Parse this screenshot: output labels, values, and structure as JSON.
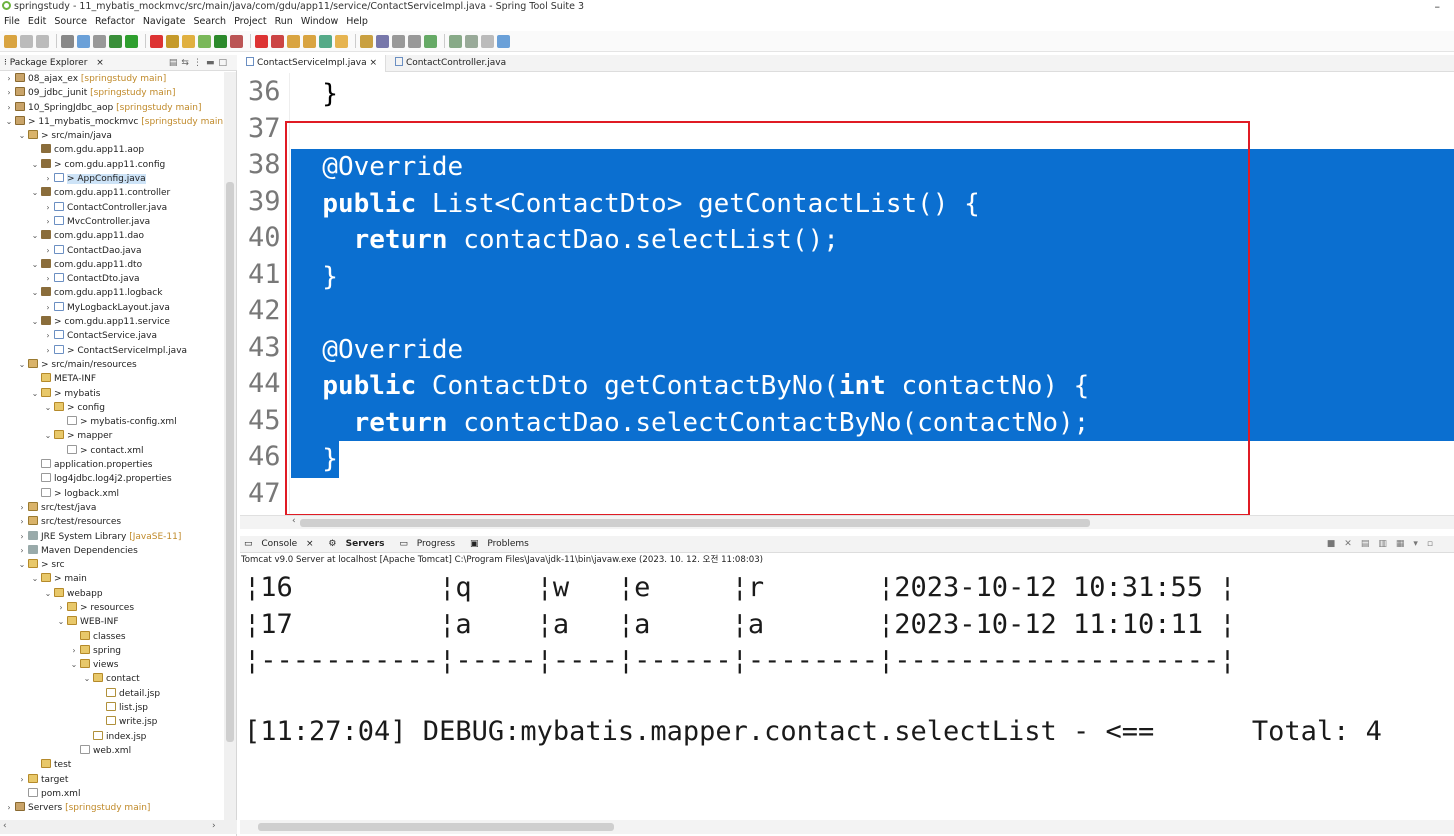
{
  "window": {
    "title": "springstudy - 11_mybatis_mockmvc/src/main/java/com/gdu/app11/service/ContactServiceImpl.java - Spring Tool Suite 3"
  },
  "menu": [
    "File",
    "Edit",
    "Source",
    "Refactor",
    "Navigate",
    "Search",
    "Project",
    "Run",
    "Window",
    "Help"
  ],
  "explorer": {
    "tab_label": "Package Explorer",
    "tree": [
      {
        "indent": 0,
        "twisty": ">",
        "icon": "proj",
        "label": "08_ajax_ex",
        "decoration": "[springstudy main]"
      },
      {
        "indent": 0,
        "twisty": ">",
        "icon": "proj",
        "label": "09_jdbc_junit",
        "decoration": "[springstudy main]"
      },
      {
        "indent": 0,
        "twisty": ">",
        "icon": "proj",
        "label": "10_SpringJdbc_aop",
        "decoration": "[springstudy main]"
      },
      {
        "indent": 0,
        "twisty": "v",
        "icon": "proj",
        "label": "> 11_mybatis_mockmvc",
        "decoration": "[springstudy main]"
      },
      {
        "indent": 1,
        "twisty": "v",
        "icon": "src",
        "label": "> src/main/java",
        "decoration": ""
      },
      {
        "indent": 2,
        "twisty": "",
        "icon": "pkg",
        "label": "com.gdu.app11.aop",
        "decoration": ""
      },
      {
        "indent": 2,
        "twisty": "v",
        "icon": "pkg",
        "label": "> com.gdu.app11.config",
        "decoration": ""
      },
      {
        "indent": 3,
        "twisty": ">",
        "icon": "java",
        "label": "> AppConfig.java",
        "decoration": "",
        "selected": true
      },
      {
        "indent": 2,
        "twisty": "v",
        "icon": "pkg",
        "label": "com.gdu.app11.controller",
        "decoration": ""
      },
      {
        "indent": 3,
        "twisty": ">",
        "icon": "java",
        "label": "ContactController.java",
        "decoration": ""
      },
      {
        "indent": 3,
        "twisty": ">",
        "icon": "java",
        "label": "MvcController.java",
        "decoration": ""
      },
      {
        "indent": 2,
        "twisty": "v",
        "icon": "pkg",
        "label": "com.gdu.app11.dao",
        "decoration": ""
      },
      {
        "indent": 3,
        "twisty": ">",
        "icon": "java",
        "label": "ContactDao.java",
        "decoration": ""
      },
      {
        "indent": 2,
        "twisty": "v",
        "icon": "pkg",
        "label": "com.gdu.app11.dto",
        "decoration": ""
      },
      {
        "indent": 3,
        "twisty": ">",
        "icon": "java",
        "label": "ContactDto.java",
        "decoration": ""
      },
      {
        "indent": 2,
        "twisty": "v",
        "icon": "pkg",
        "label": "com.gdu.app11.logback",
        "decoration": ""
      },
      {
        "indent": 3,
        "twisty": ">",
        "icon": "java",
        "label": "MyLogbackLayout.java",
        "decoration": ""
      },
      {
        "indent": 2,
        "twisty": "v",
        "icon": "pkg",
        "label": "> com.gdu.app11.service",
        "decoration": ""
      },
      {
        "indent": 3,
        "twisty": ">",
        "icon": "java",
        "label": "ContactService.java",
        "decoration": ""
      },
      {
        "indent": 3,
        "twisty": ">",
        "icon": "java",
        "label": "> ContactServiceImpl.java",
        "decoration": ""
      },
      {
        "indent": 1,
        "twisty": "v",
        "icon": "src",
        "label": "> src/main/resources",
        "decoration": ""
      },
      {
        "indent": 2,
        "twisty": "",
        "icon": "folder",
        "label": "META-INF",
        "decoration": ""
      },
      {
        "indent": 2,
        "twisty": "v",
        "icon": "folder",
        "label": "> mybatis",
        "decoration": ""
      },
      {
        "indent": 3,
        "twisty": "v",
        "icon": "folder",
        "label": "> config",
        "decoration": ""
      },
      {
        "indent": 4,
        "twisty": "",
        "icon": "xml",
        "label": "> mybatis-config.xml",
        "decoration": ""
      },
      {
        "indent": 3,
        "twisty": "v",
        "icon": "folder",
        "label": "> mapper",
        "decoration": ""
      },
      {
        "indent": 4,
        "twisty": "",
        "icon": "xml",
        "label": "> contact.xml",
        "decoration": ""
      },
      {
        "indent": 2,
        "twisty": "",
        "icon": "xml",
        "label": "application.properties",
        "decoration": ""
      },
      {
        "indent": 2,
        "twisty": "",
        "icon": "xml",
        "label": "log4jdbc.log4j2.properties",
        "decoration": ""
      },
      {
        "indent": 2,
        "twisty": "",
        "icon": "xml",
        "label": "> logback.xml",
        "decoration": ""
      },
      {
        "indent": 1,
        "twisty": ">",
        "icon": "src",
        "label": "src/test/java",
        "decoration": ""
      },
      {
        "indent": 1,
        "twisty": ">",
        "icon": "src",
        "label": "src/test/resources",
        "decoration": ""
      },
      {
        "indent": 1,
        "twisty": ">",
        "icon": "lib",
        "label": "JRE System Library",
        "decoration": "[JavaSE-11]"
      },
      {
        "indent": 1,
        "twisty": ">",
        "icon": "lib",
        "label": "Maven Dependencies",
        "decoration": ""
      },
      {
        "indent": 1,
        "twisty": "v",
        "icon": "folder",
        "label": "> src",
        "decoration": ""
      },
      {
        "indent": 2,
        "twisty": "v",
        "icon": "folder",
        "label": "> main",
        "decoration": ""
      },
      {
        "indent": 3,
        "twisty": "v",
        "icon": "folder",
        "label": "webapp",
        "decoration": ""
      },
      {
        "indent": 4,
        "twisty": ">",
        "icon": "folder",
        "label": "> resources",
        "decoration": ""
      },
      {
        "indent": 4,
        "twisty": "v",
        "icon": "folder",
        "label": "WEB-INF",
        "decoration": ""
      },
      {
        "indent": 5,
        "twisty": "",
        "icon": "folder",
        "label": "classes",
        "decoration": ""
      },
      {
        "indent": 5,
        "twisty": ">",
        "icon": "folder",
        "label": "spring",
        "decoration": ""
      },
      {
        "indent": 5,
        "twisty": "v",
        "icon": "folder",
        "label": "views",
        "decoration": ""
      },
      {
        "indent": 6,
        "twisty": "v",
        "icon": "folder",
        "label": "contact",
        "decoration": ""
      },
      {
        "indent": 7,
        "twisty": "",
        "icon": "jsp",
        "label": "detail.jsp",
        "decoration": ""
      },
      {
        "indent": 7,
        "twisty": "",
        "icon": "jsp",
        "label": "list.jsp",
        "decoration": ""
      },
      {
        "indent": 7,
        "twisty": "",
        "icon": "jsp",
        "label": "write.jsp",
        "decoration": ""
      },
      {
        "indent": 6,
        "twisty": "",
        "icon": "jsp",
        "label": "index.jsp",
        "decoration": ""
      },
      {
        "indent": 5,
        "twisty": "",
        "icon": "xml",
        "label": "web.xml",
        "decoration": ""
      },
      {
        "indent": 2,
        "twisty": "",
        "icon": "folder",
        "label": "test",
        "decoration": ""
      },
      {
        "indent": 1,
        "twisty": ">",
        "icon": "folder",
        "label": "target",
        "decoration": ""
      },
      {
        "indent": 1,
        "twisty": "",
        "icon": "xml",
        "label": "pom.xml",
        "decoration": ""
      },
      {
        "indent": 0,
        "twisty": ">",
        "icon": "proj",
        "label": "Servers",
        "decoration": "[springstudy main]"
      }
    ]
  },
  "editor": {
    "tabs": [
      "ContactServiceImpl.java",
      "ContactController.java"
    ],
    "lines": [
      {
        "no": "36",
        "text": "  }",
        "selected": false
      },
      {
        "no": "37",
        "text": "",
        "selected": false
      },
      {
        "no": "38",
        "text": "  @Override",
        "selected": true
      },
      {
        "no": "39",
        "text": "  public List<ContactDto> getContactList() {",
        "selected": true
      },
      {
        "no": "40",
        "text": "    return contactDao.selectList();",
        "selected": true
      },
      {
        "no": "41",
        "text": "  }",
        "selected": true
      },
      {
        "no": "42",
        "text": "",
        "selected": true
      },
      {
        "no": "43",
        "text": "  @Override",
        "selected": true
      },
      {
        "no": "44",
        "text": "  public ContactDto getContactByNo(int contactNo) {",
        "selected": true
      },
      {
        "no": "45",
        "text": "    return contactDao.selectContactByNo(contactNo);",
        "selected": true
      },
      {
        "no": "46",
        "text": "  }",
        "selected": "partial"
      },
      {
        "no": "47",
        "text": "",
        "selected": false
      }
    ]
  },
  "console": {
    "tabs": [
      "Console",
      "Servers",
      "Progress",
      "Problems"
    ],
    "info": "Tomcat v9.0 Server at localhost [Apache Tomcat] C:\\Program Files\\Java\\jdk-11\\bin\\javaw.exe  (2023. 10. 12. 오전 11:08:03)",
    "lines": [
      "¦16         ¦q    ¦w   ¦e     ¦r       ¦2023-10-12 10:31:55 ¦",
      "¦17         ¦a    ¦a   ¦a     ¦a       ¦2023-10-12 11:10:11 ¦",
      "¦-----------¦-----¦----¦------¦--------¦--------------------¦",
      "",
      "[11:27:04] DEBUG:mybatis.mapper.contact.selectList - <==      Total: 4"
    ]
  },
  "colors": {
    "selection": "#0b6fd0",
    "annotation_box": "#e01b24",
    "line_numbers": "#787878"
  }
}
